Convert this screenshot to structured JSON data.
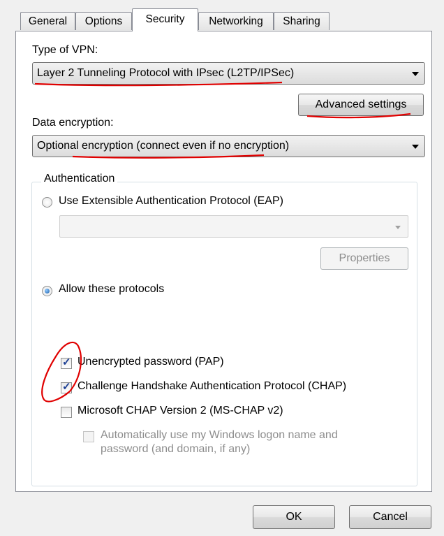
{
  "tabs": [
    {
      "label": "General",
      "active": false
    },
    {
      "label": "Options",
      "active": false
    },
    {
      "label": "Security",
      "active": true
    },
    {
      "label": "Networking",
      "active": false
    },
    {
      "label": "Sharing",
      "active": false
    }
  ],
  "vpn_type": {
    "label": "Type of VPN:",
    "value": "Layer 2 Tunneling Protocol with IPsec (L2TP/IPSec)"
  },
  "advanced_settings_label": "Advanced settings",
  "encryption": {
    "label": "Data encryption:",
    "value": "Optional encryption (connect even if no encryption)"
  },
  "authentication": {
    "title": "Authentication",
    "eap_radio_label": "Use Extensible Authentication Protocol (EAP)",
    "eap_selected": false,
    "eap_dropdown_value": "",
    "properties_label": "Properties",
    "protocols_radio_label": "Allow these protocols",
    "protocols_selected": true,
    "protocols": [
      {
        "label": "Unencrypted password (PAP)",
        "checked": true
      },
      {
        "label": "Challenge Handshake Authentication Protocol (CHAP)",
        "checked": true
      },
      {
        "label": "Microsoft CHAP Version 2 (MS-CHAP v2)",
        "checked": false
      }
    ],
    "auto_logon_label_line1": "Automatically use my Windows logon name and",
    "auto_logon_label_line2": "password (and domain, if any)",
    "auto_logon_checked": false
  },
  "footer": {
    "ok_label": "OK",
    "cancel_label": "Cancel"
  },
  "colors": {
    "annotation": "#e00000",
    "radio_selected": "#1f5fa8",
    "checkmark": "#1c3f94"
  }
}
